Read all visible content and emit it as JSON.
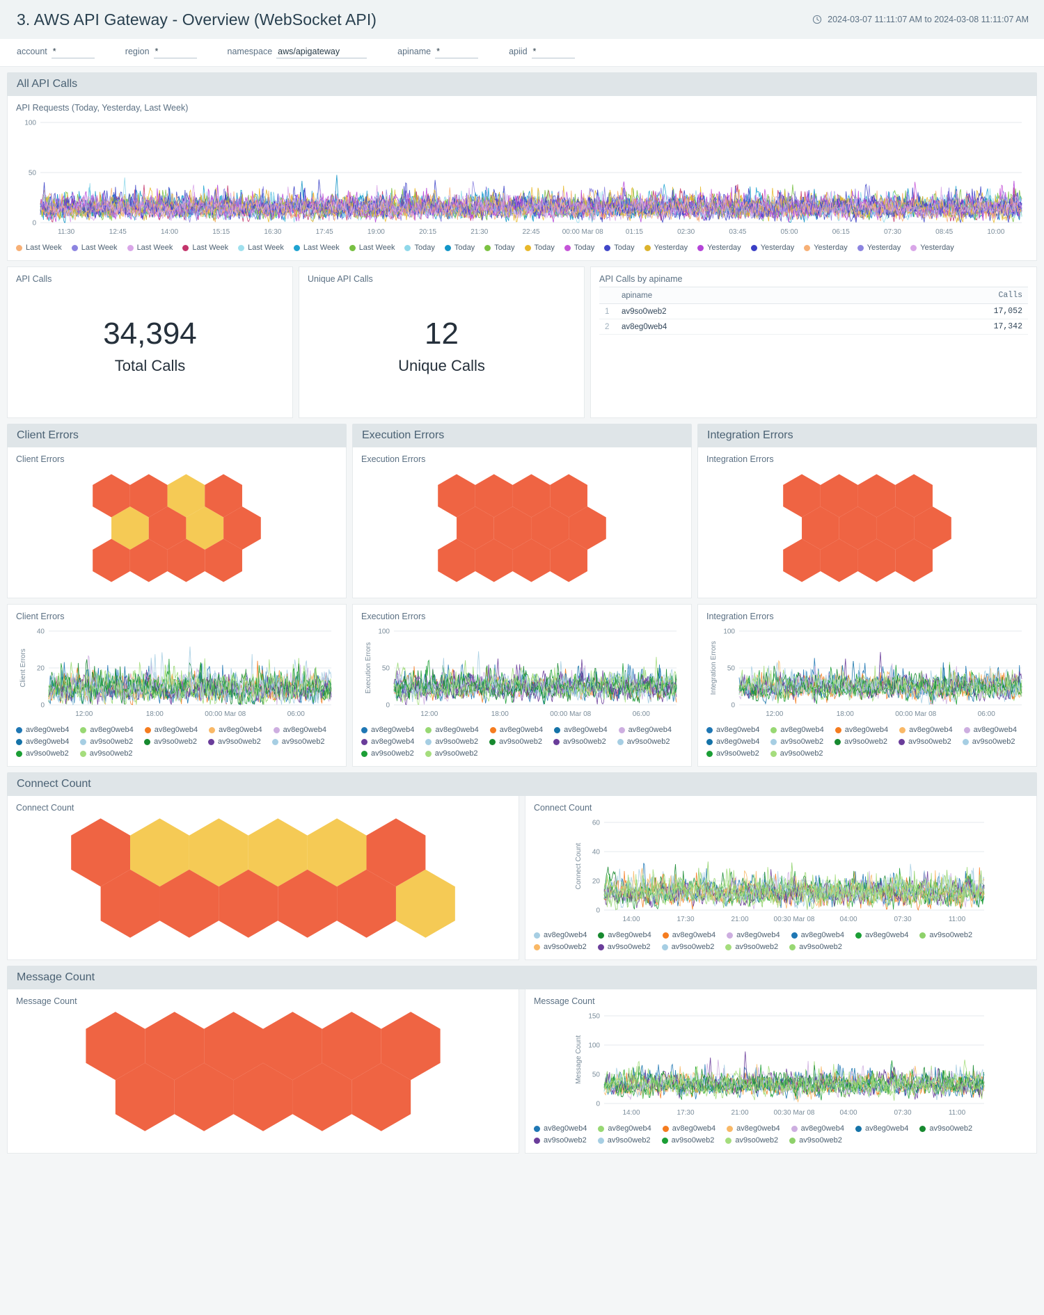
{
  "header": {
    "title": "3. AWS API Gateway - Overview (WebSocket API)",
    "time_range": "2024-03-07 11:11:07 AM to 2024-03-08 11:11:07 AM",
    "clock_icon": "clock-icon"
  },
  "filters": [
    {
      "label": "account",
      "value": "*"
    },
    {
      "label": "region",
      "value": "*"
    },
    {
      "label": "namespace",
      "value": "aws/apigateway"
    },
    {
      "label": "apiname",
      "value": "*"
    },
    {
      "label": "apiid",
      "value": "*"
    }
  ],
  "sections": {
    "all_api_calls": "All API Calls",
    "client_errors": "Client Errors",
    "execution_errors": "Execution Errors",
    "integration_errors": "Integration Errors",
    "connect_count": "Connect Count",
    "message_count": "Message Count"
  },
  "panels": {
    "api_requests": "API Requests (Today, Yesterday, Last Week)",
    "api_calls": "API Calls",
    "unique_api_calls": "Unique API Calls",
    "api_calls_by_apiname": "API Calls by apiname",
    "client_errors_hex": "Client Errors",
    "client_errors_chart": "Client Errors",
    "execution_errors_hex": "Execution Errors",
    "execution_errors_chart": "Execution Errors",
    "integration_errors_hex": "Integration Errors",
    "integration_errors_chart": "Integration Errors",
    "connect_count_hex": "Connect Count",
    "connect_count_chart": "Connect Count",
    "message_count_hex": "Message Count",
    "message_count_chart": "Message Count"
  },
  "stats": {
    "total_calls_value": "34,394",
    "total_calls_label": "Total Calls",
    "unique_calls_value": "12",
    "unique_calls_label": "Unique Calls"
  },
  "apiname_table": {
    "columns": [
      "",
      "apiname",
      "Calls"
    ],
    "rows": [
      {
        "index": "1",
        "apiname": "av9so0web2",
        "calls": "17,052"
      },
      {
        "index": "2",
        "apiname": "av8eg0web4",
        "calls": "17,342"
      }
    ]
  },
  "colors": {
    "hex_orange": "#ef6443",
    "hex_yellow": "#f5ca55",
    "section_header_bg": "#dfe5e8",
    "panel_bg": "#ffffff",
    "page_bg": "#f4f6f7",
    "title_text": "#29404f",
    "muted_text": "#5b7083"
  },
  "hex_grids": {
    "client_errors": {
      "rows": [
        [
          "orange",
          "orange",
          "yellow",
          "orange"
        ],
        [
          "yellow",
          "orange",
          "yellow",
          "orange"
        ],
        [
          "orange",
          "orange",
          "orange",
          "orange"
        ]
      ],
      "offsets": [
        0,
        1,
        0
      ]
    },
    "execution_errors": {
      "rows": [
        [
          "orange",
          "orange",
          "orange",
          "orange"
        ],
        [
          "orange",
          "orange",
          "orange",
          "orange"
        ],
        [
          "orange",
          "orange",
          "orange",
          "orange"
        ]
      ],
      "offsets": [
        0,
        1,
        0
      ]
    },
    "integration_errors": {
      "rows": [
        [
          "orange",
          "orange",
          "orange",
          "orange"
        ],
        [
          "orange",
          "orange",
          "orange",
          "orange"
        ],
        [
          "orange",
          "orange",
          "orange",
          "orange"
        ]
      ],
      "offsets": [
        0,
        1,
        0
      ]
    },
    "connect_count": {
      "rows": [
        [
          "orange",
          "yellow",
          "yellow",
          "yellow",
          "yellow",
          "orange"
        ],
        [
          "orange",
          "orange",
          "orange",
          "orange",
          "orange",
          "yellow"
        ]
      ],
      "offsets": [
        0,
        1
      ]
    },
    "message_count": {
      "rows": [
        [
          "orange",
          "orange",
          "orange",
          "orange",
          "orange",
          "orange"
        ],
        [
          "orange",
          "orange",
          "orange",
          "orange",
          "orange"
        ]
      ],
      "offsets": [
        0,
        1
      ]
    }
  },
  "chart_data": [
    {
      "id": "api_requests",
      "type": "line",
      "title": "API Requests (Today, Yesterday, Last Week)",
      "xlabel": "",
      "ylabel": "",
      "ylim": [
        0,
        100
      ],
      "yticks": [
        0,
        50,
        100
      ],
      "grid": true,
      "legend_position": "bottom",
      "xticks": [
        "11:30",
        "12:45",
        "14:00",
        "15:15",
        "16:30",
        "17:45",
        "19:00",
        "20:15",
        "21:30",
        "22:45",
        "00:00 Mar 08",
        "01:15",
        "02:30",
        "03:45",
        "05:00",
        "06:15",
        "07:30",
        "08:45",
        "10:00"
      ],
      "series": [
        {
          "name": "Last Week",
          "color": "#f7b076",
          "mean": 13,
          "amp": 18,
          "seed": 11
        },
        {
          "name": "Last Week",
          "color": "#8c84e0",
          "mean": 14,
          "amp": 20,
          "seed": 23
        },
        {
          "name": "Last Week",
          "color": "#d9a6e8",
          "mean": 12,
          "amp": 17,
          "seed": 37
        },
        {
          "name": "Last Week",
          "color": "#c3356b",
          "mean": 13,
          "amp": 19,
          "seed": 41
        },
        {
          "name": "Last Week",
          "color": "#9fe0ee",
          "mean": 12,
          "amp": 16,
          "seed": 53
        },
        {
          "name": "Last Week",
          "color": "#1fa3d1",
          "mean": 14,
          "amp": 20,
          "seed": 67
        },
        {
          "name": "Last Week",
          "color": "#78c043",
          "mean": 13,
          "amp": 18,
          "seed": 71
        },
        {
          "name": "Today",
          "color": "#8fd8ea",
          "mean": 13,
          "amp": 19,
          "seed": 83
        },
        {
          "name": "Today",
          "color": "#1295c7",
          "mean": 14,
          "amp": 20,
          "seed": 97
        },
        {
          "name": "Today",
          "color": "#7cc242",
          "mean": 13,
          "amp": 18,
          "seed": 103
        },
        {
          "name": "Today",
          "color": "#e8b82a",
          "mean": 14,
          "amp": 21,
          "seed": 109
        },
        {
          "name": "Today",
          "color": "#c554d8",
          "mean": 13,
          "amp": 19,
          "seed": 127
        },
        {
          "name": "Today",
          "color": "#4046c8",
          "mean": 14,
          "amp": 20,
          "seed": 131
        },
        {
          "name": "Yesterday",
          "color": "#dcb32c",
          "mean": 13,
          "amp": 18,
          "seed": 137
        },
        {
          "name": "Yesterday",
          "color": "#b444d8",
          "mean": 14,
          "amp": 20,
          "seed": 149
        },
        {
          "name": "Yesterday",
          "color": "#3a3fc5",
          "mean": 13,
          "amp": 19,
          "seed": 151
        },
        {
          "name": "Yesterday",
          "color": "#f7b076",
          "mean": 12,
          "amp": 17,
          "seed": 163
        },
        {
          "name": "Yesterday",
          "color": "#8c84e0",
          "mean": 13,
          "amp": 18,
          "seed": 173
        },
        {
          "name": "Yesterday",
          "color": "#d9a6e8",
          "mean": 13,
          "amp": 19,
          "seed": 181
        }
      ]
    },
    {
      "id": "client_errors",
      "type": "line",
      "title": "Client Errors",
      "ylabel": "Client Errors",
      "ylim": [
        0,
        40
      ],
      "yticks": [
        0,
        20,
        40
      ],
      "grid": true,
      "legend_position": "bottom",
      "xticks": [
        "12:00",
        "18:00",
        "00:00 Mar 08",
        "06:00"
      ],
      "series": [
        {
          "name": "av8eg0web4",
          "color": "#1f77b4",
          "mean": 8,
          "amp": 14,
          "seed": 3
        },
        {
          "name": "av8eg0web4",
          "color": "#98d873",
          "mean": 8,
          "amp": 15,
          "seed": 7
        },
        {
          "name": "av8eg0web4",
          "color": "#f57c1f",
          "mean": 7,
          "amp": 14,
          "seed": 13
        },
        {
          "name": "av8eg0web4",
          "color": "#f9b866",
          "mean": 8,
          "amp": 13,
          "seed": 19
        },
        {
          "name": "av8eg0web4",
          "color": "#cdaee0",
          "mean": 8,
          "amp": 15,
          "seed": 29
        },
        {
          "name": "av8eg0web4",
          "color": "#1573a8",
          "mean": 7,
          "amp": 14,
          "seed": 31
        },
        {
          "name": "av9so0web2",
          "color": "#a6cee3",
          "mean": 8,
          "amp": 16,
          "seed": 43
        },
        {
          "name": "av9so0web2",
          "color": "#17892f",
          "mean": 8,
          "amp": 15,
          "seed": 47
        },
        {
          "name": "av9so0web2",
          "color": "#6a3d9a",
          "mean": 7,
          "amp": 14,
          "seed": 59
        },
        {
          "name": "av9so0web2",
          "color": "#a6cee3",
          "mean": 8,
          "amp": 14,
          "seed": 61
        },
        {
          "name": "av9so0web2",
          "color": "#1b9e35",
          "mean": 8,
          "amp": 15,
          "seed": 73
        },
        {
          "name": "av9so0web2",
          "color": "#a5dd7d",
          "mean": 8,
          "amp": 16,
          "seed": 79
        }
      ]
    },
    {
      "id": "execution_errors",
      "type": "line",
      "title": "Execution Errors",
      "ylabel": "Execution Errors",
      "ylim": [
        0,
        100
      ],
      "yticks": [
        0,
        50,
        100
      ],
      "grid": true,
      "legend_position": "bottom",
      "xticks": [
        "12:00",
        "18:00",
        "00:00 Mar 08",
        "06:00"
      ],
      "series": [
        {
          "name": "av8eg0web4",
          "color": "#1f77b4",
          "mean": 22,
          "amp": 30,
          "seed": 5
        },
        {
          "name": "av8eg0web4",
          "color": "#98d873",
          "mean": 22,
          "amp": 32,
          "seed": 11
        },
        {
          "name": "av8eg0web4",
          "color": "#f57c1f",
          "mean": 21,
          "amp": 30,
          "seed": 17
        },
        {
          "name": "av8eg0web4",
          "color": "#1573a8",
          "mean": 22,
          "amp": 31,
          "seed": 23
        },
        {
          "name": "av8eg0web4",
          "color": "#cdaee0",
          "mean": 22,
          "amp": 30,
          "seed": 37
        },
        {
          "name": "av8eg0web4",
          "color": "#6a3d9a",
          "mean": 21,
          "amp": 32,
          "seed": 41
        },
        {
          "name": "av9so0web2",
          "color": "#a6cee3",
          "mean": 22,
          "amp": 31,
          "seed": 53
        },
        {
          "name": "av9so0web2",
          "color": "#17892f",
          "mean": 22,
          "amp": 30,
          "seed": 67
        },
        {
          "name": "av9so0web2",
          "color": "#6a3d9a",
          "mean": 21,
          "amp": 31,
          "seed": 71
        },
        {
          "name": "av9so0web2",
          "color": "#a6cee3",
          "mean": 22,
          "amp": 30,
          "seed": 83
        },
        {
          "name": "av9so0web2",
          "color": "#1b9e35",
          "mean": 22,
          "amp": 32,
          "seed": 89
        },
        {
          "name": "av9so0web2",
          "color": "#a5dd7d",
          "mean": 22,
          "amp": 31,
          "seed": 97
        }
      ]
    },
    {
      "id": "integration_errors",
      "type": "line",
      "title": "Integration Errors",
      "ylabel": "Integration Errors",
      "ylim": [
        0,
        100
      ],
      "yticks": [
        0,
        50,
        100
      ],
      "grid": true,
      "legend_position": "bottom",
      "xticks": [
        "12:00",
        "18:00",
        "00:00 Mar 08",
        "06:00"
      ],
      "series": [
        {
          "name": "av8eg0web4",
          "color": "#1f77b4",
          "mean": 22,
          "amp": 31,
          "seed": 2
        },
        {
          "name": "av8eg0web4",
          "color": "#98d873",
          "mean": 22,
          "amp": 30,
          "seed": 13
        },
        {
          "name": "av8eg0web4",
          "color": "#f57c1f",
          "mean": 21,
          "amp": 32,
          "seed": 19
        },
        {
          "name": "av8eg0web4",
          "color": "#f9b866",
          "mean": 22,
          "amp": 30,
          "seed": 29
        },
        {
          "name": "av8eg0web4",
          "color": "#cdaee0",
          "mean": 22,
          "amp": 31,
          "seed": 31
        },
        {
          "name": "av8eg0web4",
          "color": "#1573a8",
          "mean": 21,
          "amp": 30,
          "seed": 43
        },
        {
          "name": "av9so0web2",
          "color": "#a6cee3",
          "mean": 22,
          "amp": 32,
          "seed": 47
        },
        {
          "name": "av9so0web2",
          "color": "#17892f",
          "mean": 22,
          "amp": 31,
          "seed": 59
        },
        {
          "name": "av9so0web2",
          "color": "#6a3d9a",
          "mean": 21,
          "amp": 30,
          "seed": 61
        },
        {
          "name": "av9so0web2",
          "color": "#a6cee3",
          "mean": 22,
          "amp": 31,
          "seed": 73
        },
        {
          "name": "av9so0web2",
          "color": "#1b9e35",
          "mean": 22,
          "amp": 30,
          "seed": 79
        },
        {
          "name": "av9so0web2",
          "color": "#a5dd7d",
          "mean": 22,
          "amp": 32,
          "seed": 101
        }
      ]
    },
    {
      "id": "connect_count",
      "type": "line",
      "title": "Connect Count",
      "ylabel": "Connect Count",
      "ylim": [
        0,
        60
      ],
      "yticks": [
        0,
        20,
        40,
        60
      ],
      "grid": true,
      "legend_position": "bottom",
      "xticks": [
        "14:00",
        "17:30",
        "21:00",
        "00:30 Mar 08",
        "04:00",
        "07:30",
        "11:00"
      ],
      "series": [
        {
          "name": "av8eg0web4",
          "color": "#a6cee3",
          "mean": 11,
          "amp": 16,
          "seed": 3
        },
        {
          "name": "av8eg0web4",
          "color": "#17892f",
          "mean": 11,
          "amp": 17,
          "seed": 11
        },
        {
          "name": "av8eg0web4",
          "color": "#f57c1f",
          "mean": 10,
          "amp": 16,
          "seed": 17
        },
        {
          "name": "av8eg0web4",
          "color": "#cdaee0",
          "mean": 11,
          "amp": 15,
          "seed": 23
        },
        {
          "name": "av8eg0web4",
          "color": "#1f77b4",
          "mean": 11,
          "amp": 17,
          "seed": 29
        },
        {
          "name": "av8eg0web4",
          "color": "#1b9e35",
          "mean": 10,
          "amp": 16,
          "seed": 37
        },
        {
          "name": "av9so0web2",
          "color": "#8ed16a",
          "mean": 11,
          "amp": 17,
          "seed": 41
        },
        {
          "name": "av9so0web2",
          "color": "#f9b866",
          "mean": 11,
          "amp": 16,
          "seed": 47
        },
        {
          "name": "av9so0web2",
          "color": "#6a3d9a",
          "mean": 10,
          "amp": 15,
          "seed": 53
        },
        {
          "name": "av9so0web2",
          "color": "#a6cee3",
          "mean": 11,
          "amp": 17,
          "seed": 59
        },
        {
          "name": "av9so0web2",
          "color": "#a5dd7d",
          "mean": 11,
          "amp": 16,
          "seed": 67
        },
        {
          "name": "av9so0web2",
          "color": "#98d873",
          "mean": 11,
          "amp": 16,
          "seed": 71
        }
      ]
    },
    {
      "id": "message_count",
      "type": "line",
      "title": "Message Count",
      "ylabel": "Message Count",
      "ylim": [
        0,
        150
      ],
      "yticks": [
        0,
        50,
        100,
        150
      ],
      "grid": true,
      "legend_position": "bottom",
      "xticks": [
        "14:00",
        "17:30",
        "21:00",
        "00:30 Mar 08",
        "04:00",
        "07:30",
        "11:00"
      ],
      "series": [
        {
          "name": "av8eg0web4",
          "color": "#1f77b4",
          "mean": 30,
          "amp": 34,
          "seed": 5
        },
        {
          "name": "av8eg0web4",
          "color": "#98d873",
          "mean": 30,
          "amp": 35,
          "seed": 13
        },
        {
          "name": "av8eg0web4",
          "color": "#f57c1f",
          "mean": 29,
          "amp": 33,
          "seed": 19
        },
        {
          "name": "av8eg0web4",
          "color": "#f9b866",
          "mean": 30,
          "amp": 34,
          "seed": 31
        },
        {
          "name": "av8eg0web4",
          "color": "#cdaee0",
          "mean": 30,
          "amp": 35,
          "seed": 43
        },
        {
          "name": "av8eg0web4",
          "color": "#1573a8",
          "mean": 29,
          "amp": 33,
          "seed": 47
        },
        {
          "name": "av9so0web2",
          "color": "#17892f",
          "mean": 30,
          "amp": 34,
          "seed": 59
        },
        {
          "name": "av9so0web2",
          "color": "#6a3d9a",
          "mean": 30,
          "amp": 35,
          "seed": 61
        },
        {
          "name": "av9so0web2",
          "color": "#a6cee3",
          "mean": 29,
          "amp": 33,
          "seed": 73
        },
        {
          "name": "av9so0web2",
          "color": "#1b9e35",
          "mean": 30,
          "amp": 34,
          "seed": 79
        },
        {
          "name": "av9so0web2",
          "color": "#a5dd7d",
          "mean": 30,
          "amp": 35,
          "seed": 89
        },
        {
          "name": "av9so0web2",
          "color": "#8ed16a",
          "mean": 29,
          "amp": 33,
          "seed": 101
        }
      ]
    }
  ]
}
